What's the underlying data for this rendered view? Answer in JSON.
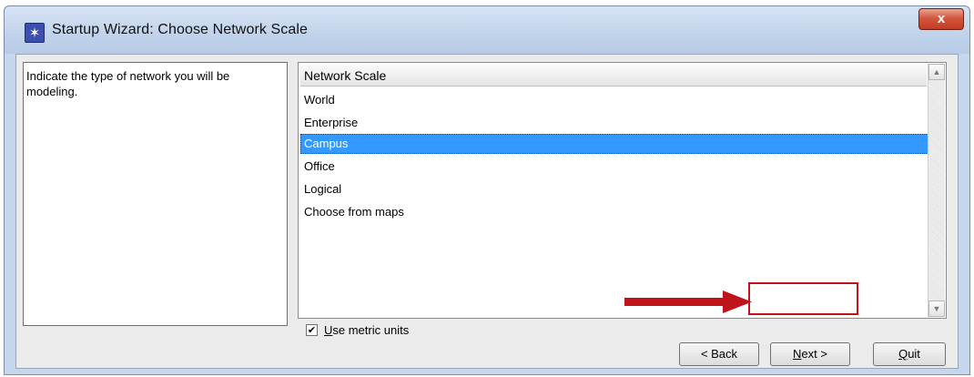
{
  "window": {
    "title": "Startup Wizard: Choose Network Scale",
    "close_label": "x"
  },
  "description": "Indicate the type of network you will be modeling.",
  "list": {
    "header": "Network Scale",
    "items": [
      {
        "label": "World",
        "selected": false
      },
      {
        "label": "Enterprise",
        "selected": false
      },
      {
        "label": "Campus",
        "selected": true
      },
      {
        "label": "Office",
        "selected": false
      },
      {
        "label": "Logical",
        "selected": false
      },
      {
        "label": "Choose from maps",
        "selected": false
      }
    ]
  },
  "checkbox": {
    "checked": true,
    "label_mnemonic": "U",
    "label_rest": "se metric units"
  },
  "buttons": {
    "back": "< Back",
    "next_mnemonic": "N",
    "next_rest": "ext >",
    "quit_mnemonic": "Q",
    "quit_rest": "uit"
  },
  "colors": {
    "selection": "#3399ff",
    "annotation": "#c0141b"
  }
}
